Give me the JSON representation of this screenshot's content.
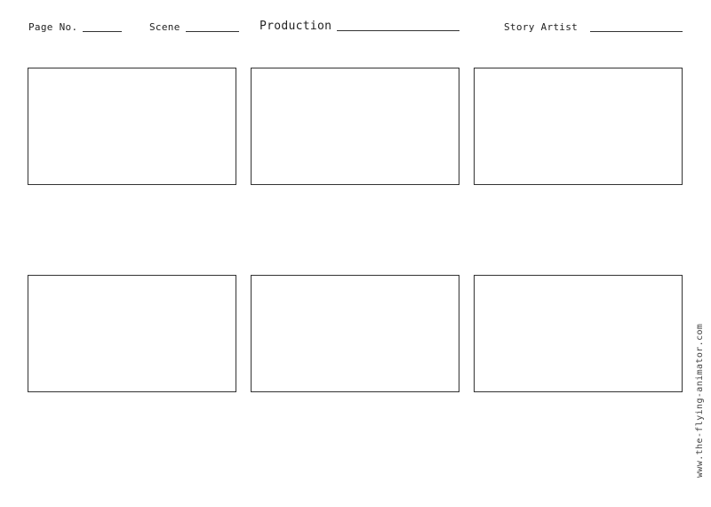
{
  "header": {
    "page_no_label": "Page No.",
    "scene_label": "Scene",
    "production_label": "Production",
    "story_artist_label": "Story Artist"
  },
  "panels": [
    {
      "id": 1
    },
    {
      "id": 2
    },
    {
      "id": 3
    },
    {
      "id": 4
    },
    {
      "id": 5
    },
    {
      "id": 6
    }
  ],
  "footer": {
    "website": "www.the-flying-animator.com"
  }
}
